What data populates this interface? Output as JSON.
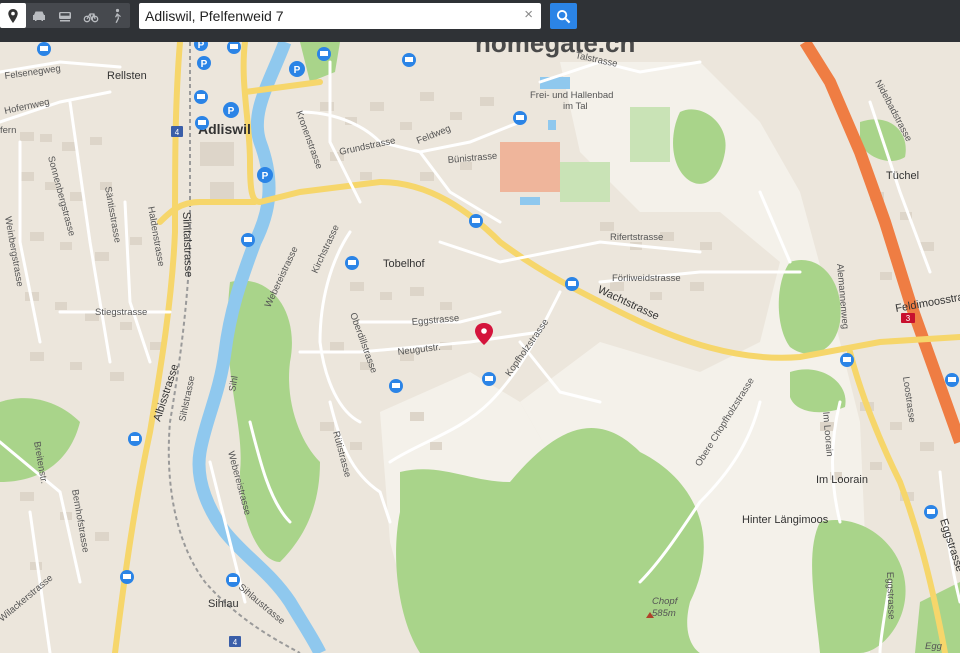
{
  "search": {
    "value": "Adliswil, Pfelfenweid 7",
    "clear": "×"
  },
  "modes": [
    {
      "name": "location",
      "active": true
    },
    {
      "name": "car",
      "active": false
    },
    {
      "name": "train",
      "active": false
    },
    {
      "name": "bike",
      "active": false
    },
    {
      "name": "walk",
      "active": false
    }
  ],
  "watermark": "homegate.ch",
  "labels": {
    "adliswil": "Adliswil",
    "tobelhof": "Tobelhof",
    "tuchel": "Tüchel",
    "rellsten": "Rellsten",
    "freibad": "Frei- und Hallenbad",
    "imtal": "im Tal",
    "hinter": "Hinter Längimoos",
    "imloorain": "Im Loorain",
    "sihlau": "Sihlau",
    "chopf": "Chopf",
    "chopf_h": "585m",
    "fern": "fern",
    "egg": "Egg"
  },
  "streets": {
    "felsenegg": "Felsenegweg",
    "hofern": "Hofernweg",
    "talstrasse": "Talstrasse",
    "nidelbad": "Nidelbadstrasse",
    "feldweg": "Feldweg",
    "grund": "Grundstrasse",
    "kronen": "Kronenstrasse",
    "buni": "Bünistrasse",
    "rifert": "Rifertstrasse",
    "forliweid": "Förliweidstrasse",
    "wacht": "Wachtstrasse",
    "egg": "Eggstrasse",
    "neugut": "Neugutstr.",
    "oberdil": "Oberdillstrasse",
    "kirch": "Kirchstrasse",
    "weberei": "Webereistrasse",
    "weberei2": "Webereistrasse",
    "sihltal": "Sihltalstrasse",
    "albis": "Albisstrasse",
    "sihlstr": "Sihlstrasse",
    "sihlau": "Sihlaustrasse",
    "stieg": "Stiegstrasse",
    "sonnenberg": "Sonnenbergstrasse",
    "sant": "Säntisstrasse",
    "halden": "Haldenstrasse",
    "weinberg": "Weinbergstrasse",
    "breiten": "Breitenstr.",
    "bernhof": "Bernhofstrasse",
    "wilacker": "Wilackerstrasse",
    "kopfholz": "Kopfholzstrasse",
    "ruti": "Rütistrasse",
    "oberechopf": "Obere Chopfholzstrasse",
    "loor": "Loostrasse",
    "alemannen": "Alemannenweg",
    "feldimoos": "Feldimoosstrasse",
    "eggstr2": "Eggstrasse",
    "egg_south": "Eggstrasse",
    "sihl": "Sihl",
    "imloor": "Im Loorain"
  },
  "shields": {
    "a": "4",
    "b": "4",
    "c": "3"
  },
  "colors": {
    "accent": "#2b84e6",
    "pin": "#d4143c",
    "motorway": "#ef7d43",
    "main": "#f6d66b",
    "water": "#8fc8ee",
    "forest": "#a9d48a"
  }
}
